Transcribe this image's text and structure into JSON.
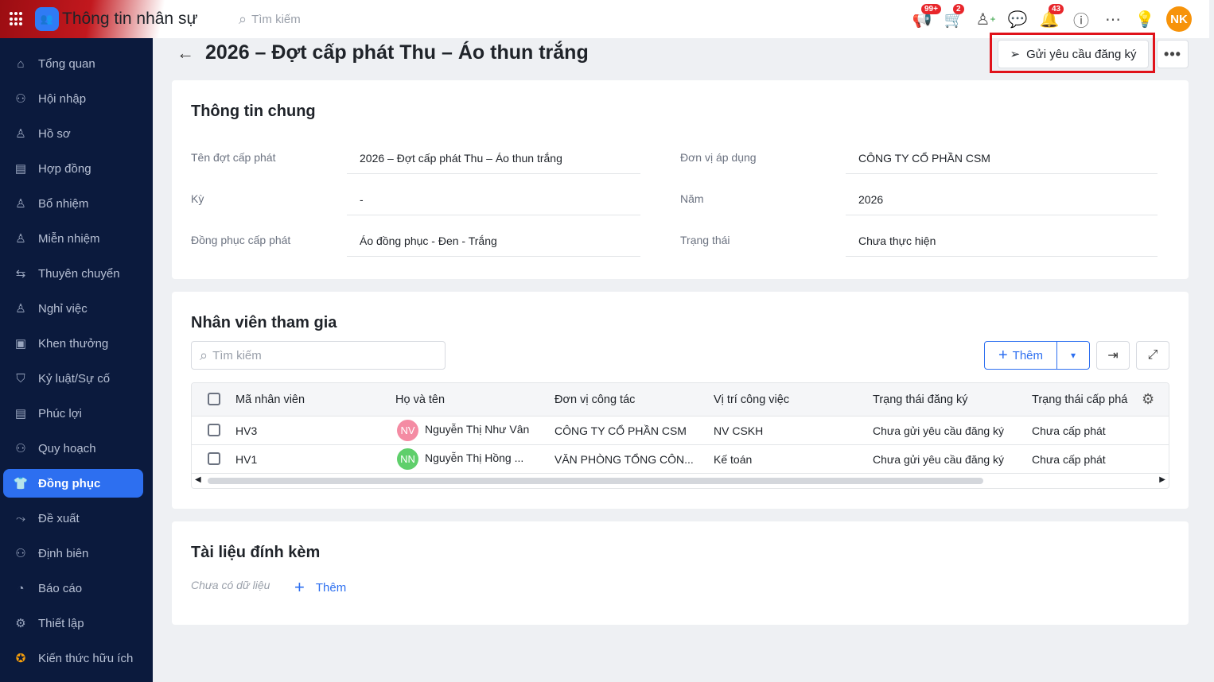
{
  "header": {
    "app_title": "Thông tin nhân sự",
    "search_placeholder": "Tìm kiếm",
    "badges": {
      "announcements": "99+",
      "cart": "2",
      "notifications": "43"
    },
    "avatar": "NK"
  },
  "sidebar": {
    "items": [
      {
        "label": "Tổng quan",
        "icon": "⌂"
      },
      {
        "label": "Hội nhập",
        "icon": "⚇"
      },
      {
        "label": "Hồ sơ",
        "icon": "♙"
      },
      {
        "label": "Hợp đồng",
        "icon": "▤"
      },
      {
        "label": "Bổ nhiệm",
        "icon": "♙"
      },
      {
        "label": "Miễn nhiệm",
        "icon": "♙"
      },
      {
        "label": "Thuyên chuyển",
        "icon": "⇆"
      },
      {
        "label": "Nghỉ việc",
        "icon": "♙"
      },
      {
        "label": "Khen thưởng",
        "icon": "▣"
      },
      {
        "label": "Kỷ luật/Sự cố",
        "icon": "⛉"
      },
      {
        "label": "Phúc lợi",
        "icon": "▤"
      },
      {
        "label": "Quy hoạch",
        "icon": "⚇"
      },
      {
        "label": "Đồng phục",
        "icon": "👕"
      },
      {
        "label": "Đề xuất",
        "icon": "⤳"
      },
      {
        "label": "Định biên",
        "icon": "⚇"
      },
      {
        "label": "Báo cáo",
        "icon": "◔"
      },
      {
        "label": "Thiết lập",
        "icon": "⚙"
      },
      {
        "label": "Kiến thức hữu ích",
        "icon": "✪"
      }
    ],
    "active": "Đồng phục"
  },
  "page": {
    "title": "2026 – Đợt cấp phát Thu – Áo thun trắng",
    "send_button": "Gửi yêu cầu đăng ký",
    "more": "•••"
  },
  "general": {
    "title": "Thông tin chung",
    "fields": [
      {
        "label": "Tên đợt cấp phát",
        "value": "2026 – Đợt cấp phát Thu – Áo thun trắng"
      },
      {
        "label": "Đơn vị áp dụng",
        "value": "CÔNG TY CỔ PHẦN CSM"
      },
      {
        "label": "Kỳ",
        "value": "-"
      },
      {
        "label": "Năm",
        "value": "2026"
      },
      {
        "label": "Đồng phục cấp phát",
        "value": "Áo đồng phục - Đen - Trắng"
      },
      {
        "label": "Trạng thái",
        "value": "Chưa thực hiện"
      }
    ]
  },
  "participants": {
    "title": "Nhân viên tham gia",
    "search_placeholder": "Tìm kiếm",
    "add_label": "Thêm",
    "columns": [
      "Mã nhân viên",
      "Họ và tên",
      "Đơn vị công tác",
      "Vị trí công việc",
      "Trạng thái đăng ký",
      "Trạng thái cấp phá"
    ],
    "rows": [
      {
        "code": "HV3",
        "initials": "NV",
        "avatar_color": "#f48ba3",
        "name": "Nguyễn Thị Như Vân",
        "unit": "CÔNG TY CỔ PHẦN CSM",
        "position": "NV CSKH",
        "reg_status": "Chưa gửi yêu cầu đăng ký",
        "issue_status": "Chưa cấp phát"
      },
      {
        "code": "HV1",
        "initials": "NN",
        "avatar_color": "#5fcf6b",
        "name": "Nguyễn Thị Hồng ...",
        "unit": "VĂN PHÒNG TỔNG CÔN...",
        "position": "Kế toán",
        "reg_status": "Chưa gửi yêu cầu đăng ký",
        "issue_status": "Chưa cấp phát"
      }
    ]
  },
  "attachments": {
    "title": "Tài liệu đính kèm",
    "empty": "Chưa có dữ liệu",
    "add_label": "Thêm"
  }
}
